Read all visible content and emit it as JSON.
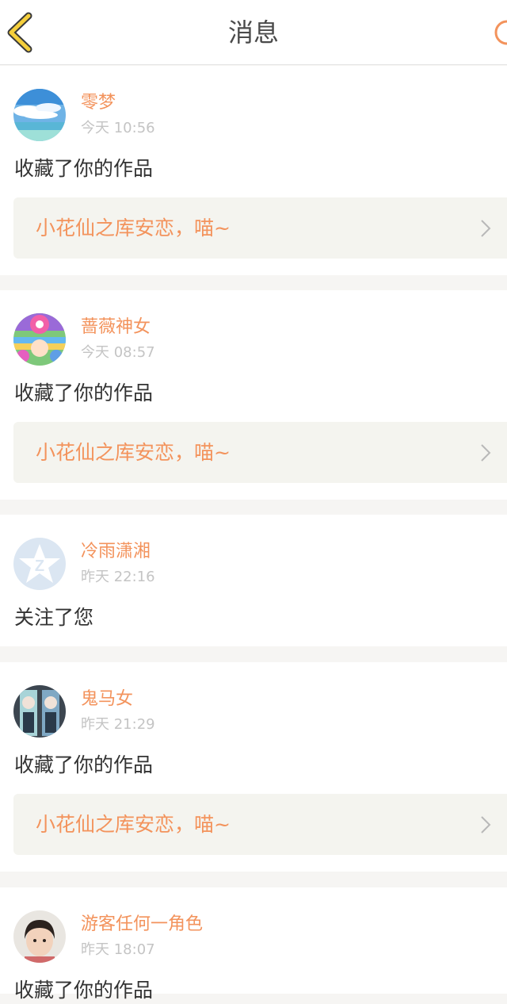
{
  "header": {
    "title": "消息",
    "back_icon": "chevron-left-icon",
    "action_icon": "circle-icon",
    "accent_color": "#f5cf3c"
  },
  "colors": {
    "username": "#f3935c",
    "work_title": "#f3935c",
    "timestamp": "#c4c4c4",
    "body_text": "#333333",
    "separator": "#f6f5f3",
    "work_box": "#f4f4ef"
  },
  "messages": [
    {
      "username": "零梦",
      "time": "今天 10:56",
      "action": "收藏了你的作品",
      "work_title": "小花仙之库安恋，喵~",
      "avatar": "sky-sea-avatar"
    },
    {
      "username": "蔷薇神女",
      "time": "今天 08:57",
      "action": "收藏了你的作品",
      "work_title": "小花仙之库安恋，喵~",
      "avatar": "anime-colorful-avatar"
    },
    {
      "username": "冷雨潇湘",
      "time": "昨天 22:16",
      "action": "关注了您",
      "avatar": "default-qq-avatar"
    },
    {
      "username": "鬼马女",
      "time": "昨天 21:29",
      "action": "收藏了你的作品",
      "work_title": "小花仙之库安恋，喵~",
      "avatar": "anime-twins-avatar"
    },
    {
      "username": "游客任何一角色",
      "time": "昨天 18:07",
      "action": "收藏了你的作品",
      "avatar": "girl-photo-avatar"
    }
  ]
}
